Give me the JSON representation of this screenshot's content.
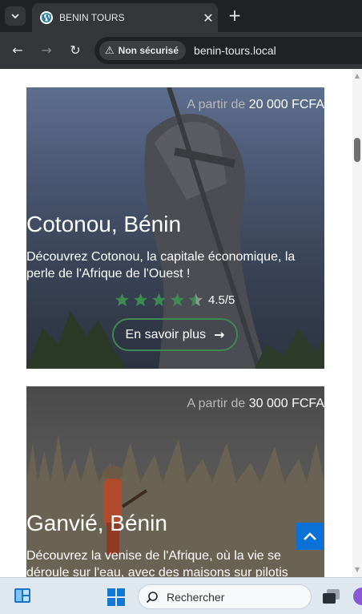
{
  "browser": {
    "tab_title": "BENIN TOURS",
    "favicon_letter": "W",
    "tab_menu_icon": "chevron-down-icon",
    "close_icon": "✕",
    "new_tab_icon": "+",
    "back_icon": "←",
    "forward_icon": "→",
    "reload_icon": "↻",
    "security_warning_icon": "⚠",
    "security_label": "Non sécurisé",
    "url": "benin-tours.local"
  },
  "cards": [
    {
      "price_prefix": "A partir de",
      "price": "20 000 FCFA",
      "title": "Cotonou, Bénin",
      "description": "Découvrez Cotonou, la capitale économique, la perle de l'Afrique de l'Ouest !",
      "rating": 4.5,
      "rating_text": "4.5/5",
      "button_label": "En savoir plus",
      "button_arrow": "→"
    },
    {
      "price_prefix": "A partir de",
      "price": "30 000 FCFA",
      "title": "Ganvié, Bénin",
      "description": "Découvrez la venise de l'Afrique, où la vie se déroule sur l'eau, avec des maisons sur pilotis"
    }
  ],
  "taskbar": {
    "search_icon": "⚲",
    "search_placeholder": "Rechercher"
  },
  "colors": {
    "star": "#3d8a52",
    "button_border": "#3d8a52",
    "back_to_top": "#0a72d6",
    "browser_dark": "#202124",
    "browser_toolbar": "#35363a"
  }
}
